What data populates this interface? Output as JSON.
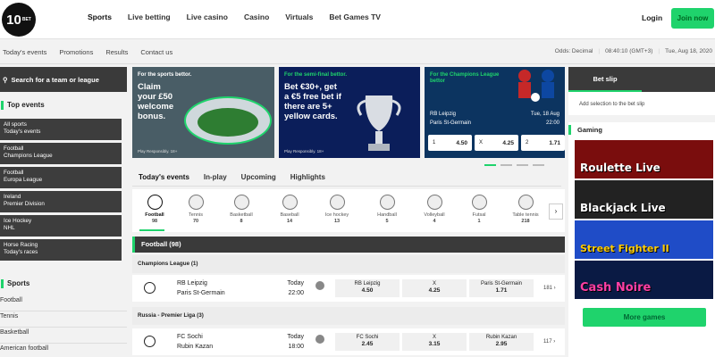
{
  "brand": {
    "logo_text": "10",
    "logo_sub": "BET",
    "accent": "#1fd36c"
  },
  "header": {
    "nav": [
      "Sports",
      "Live betting",
      "Live casino",
      "Casino",
      "Virtuals",
      "Bet Games TV"
    ],
    "login": "Login",
    "join": "Join now"
  },
  "subnav": {
    "links": [
      "Today's events",
      "Promotions",
      "Results",
      "Contact us"
    ],
    "odds": "Odds:  Decimal",
    "time": "08:40:10  (GMT+3)",
    "date": "Tue, Aug 18, 2020"
  },
  "sidebar": {
    "search_placeholder": "Search for a team or league",
    "top_events_title": "Top events",
    "top_events": [
      {
        "l1": "All sports",
        "l2": "Today's events"
      },
      {
        "l1": "Football",
        "l2": "Champions League"
      },
      {
        "l1": "Football",
        "l2": "Europa League"
      },
      {
        "l1": "Ireland",
        "l2": "Premier Division"
      },
      {
        "l1": "Ice Hockey",
        "l2": "NHL"
      },
      {
        "l1": "Horse Racing",
        "l2": "Today's races"
      }
    ],
    "sports_title": "Sports",
    "sports": [
      "Football",
      "Tennis",
      "Basketball",
      "American football"
    ]
  },
  "banners": [
    {
      "title": "For the sports bettor.",
      "headline": [
        "Claim",
        "your £50",
        "welcome",
        "bonus."
      ],
      "foot": "Play Responsibly. 18+"
    },
    {
      "title": "For the semi-final bettor.",
      "headline": [
        "Bet €30+, get",
        "a €5 free bet if",
        "there are 5+",
        "yellow cards."
      ],
      "foot": "Play Responsibly. 18+"
    },
    {
      "title": "For the Champions League bettor",
      "home": "RB Leipzig",
      "away": "Paris St-Germain",
      "date": "Tue, 18 Aug",
      "kickoff": "22:00",
      "odds": [
        {
          "k": "1",
          "v": "4.50"
        },
        {
          "k": "X",
          "v": "4.25"
        },
        {
          "k": "2",
          "v": "1.71"
        }
      ]
    }
  ],
  "event_tabs": [
    "Today's events",
    "In-play",
    "Upcoming",
    "Highlights"
  ],
  "sport_strip": [
    {
      "name": "Football",
      "count": "98"
    },
    {
      "name": "Tennis",
      "count": "70"
    },
    {
      "name": "Basketball",
      "count": "8"
    },
    {
      "name": "Baseball",
      "count": "14"
    },
    {
      "name": "Ice hockey",
      "count": "13"
    },
    {
      "name": "Handball",
      "count": "5"
    },
    {
      "name": "Volleyball",
      "count": "4"
    },
    {
      "name": "Futsal",
      "count": "1"
    },
    {
      "name": "Table tennis",
      "count": "218"
    }
  ],
  "football_header": "Football  (98)",
  "leagues": [
    {
      "name": "Champions League  (1)",
      "match": {
        "home": "RB Leipzig",
        "away": "Paris St-Germain",
        "day": "Today",
        "time": "22:00",
        "sel": [
          {
            "n": "RB Leipzig",
            "o": "4.50"
          },
          {
            "n": "X",
            "o": "4.25"
          },
          {
            "n": "Paris St-Germain",
            "o": "1.71"
          }
        ],
        "more": "181"
      }
    },
    {
      "name": "Russia - Premier Liga  (3)",
      "match": {
        "home": "FC Sochi",
        "away": "Rubin Kazan",
        "day": "Today",
        "time": "18:00",
        "sel": [
          {
            "n": "FC Sochi",
            "o": "2.45"
          },
          {
            "n": "X",
            "o": "3.15"
          },
          {
            "n": "Rubin Kazan",
            "o": "2.95"
          }
        ],
        "more": "117"
      }
    }
  ],
  "betslip": {
    "title": "Bet slip",
    "empty": "Add selection to the bet slip"
  },
  "gaming": {
    "title": "Gaming",
    "games": [
      "Roulette Live",
      "Blackjack Live",
      "Street Fighter II",
      "Cash Noire"
    ],
    "more": "More games"
  }
}
